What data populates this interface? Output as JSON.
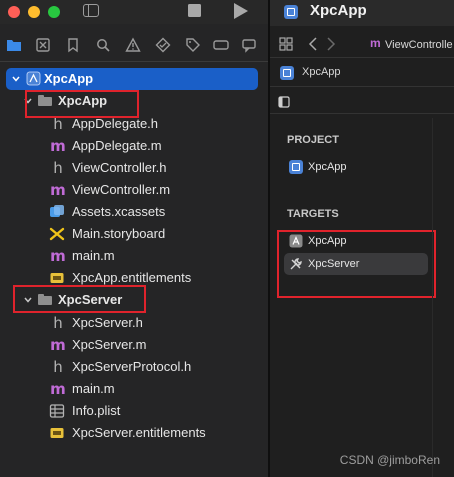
{
  "toolbar": {
    "window_controls": [
      "close",
      "minimize",
      "zoom"
    ],
    "sidebar_toggle_icon": "sidebar-icon",
    "stop_icon": "stop-icon",
    "run_icon": "play-icon"
  },
  "navigator_icons": [
    "folder-icon",
    "x-square-icon",
    "bookmark-icon",
    "magnifier-icon",
    "warning-icon",
    "diamond-icon",
    "tag-icon",
    "rect-icon",
    "speech-icon"
  ],
  "tree": {
    "project": {
      "label": "XpcApp",
      "icon": "xcode-project-icon"
    },
    "groups": [
      {
        "label": "XpcApp",
        "files": [
          {
            "label": "AppDelegate.h",
            "icon": "h"
          },
          {
            "label": "AppDelegate.m",
            "icon": "m"
          },
          {
            "label": "ViewController.h",
            "icon": "h"
          },
          {
            "label": "ViewController.m",
            "icon": "m"
          },
          {
            "label": "Assets.xcassets",
            "icon": "assets"
          },
          {
            "label": "Main.storyboard",
            "icon": "storyboard"
          },
          {
            "label": "main.m",
            "icon": "m"
          },
          {
            "label": "XpcApp.entitlements",
            "icon": "entitlements"
          }
        ]
      },
      {
        "label": "XpcServer",
        "files": [
          {
            "label": "XpcServer.h",
            "icon": "h"
          },
          {
            "label": "XpcServer.m",
            "icon": "m"
          },
          {
            "label": "XpcServerProtocol.h",
            "icon": "h"
          },
          {
            "label": "main.m",
            "icon": "m"
          },
          {
            "label": "Info.plist",
            "icon": "plist"
          },
          {
            "label": "XpcServer.entitlements",
            "icon": "entitlements"
          }
        ]
      }
    ]
  },
  "editor": {
    "window_title": "XpcApp",
    "tab_label": "ViewControlle",
    "tab_glyph": "m",
    "jump_label": "XpcApp",
    "project_section": "PROJECT",
    "project_item": "XpcApp",
    "targets_section": "TARGETS",
    "targets": [
      {
        "label": "XpcApp",
        "icon": "app-target-icon",
        "selected": false
      },
      {
        "label": "XpcServer",
        "icon": "tools-icon",
        "selected": true
      }
    ]
  },
  "watermark": "CSDN @jimboRen",
  "colors": {
    "selection": "#1a5fc8",
    "highlight_box": "#e0232c",
    "m_file": "#c06bd6",
    "h_file": "#b3b3b3",
    "asset": "#4a9be8",
    "storyboard": "#f0c419",
    "entitlements": "#e8c13a"
  },
  "glyphs": {
    "h": "h",
    "m": "m"
  }
}
